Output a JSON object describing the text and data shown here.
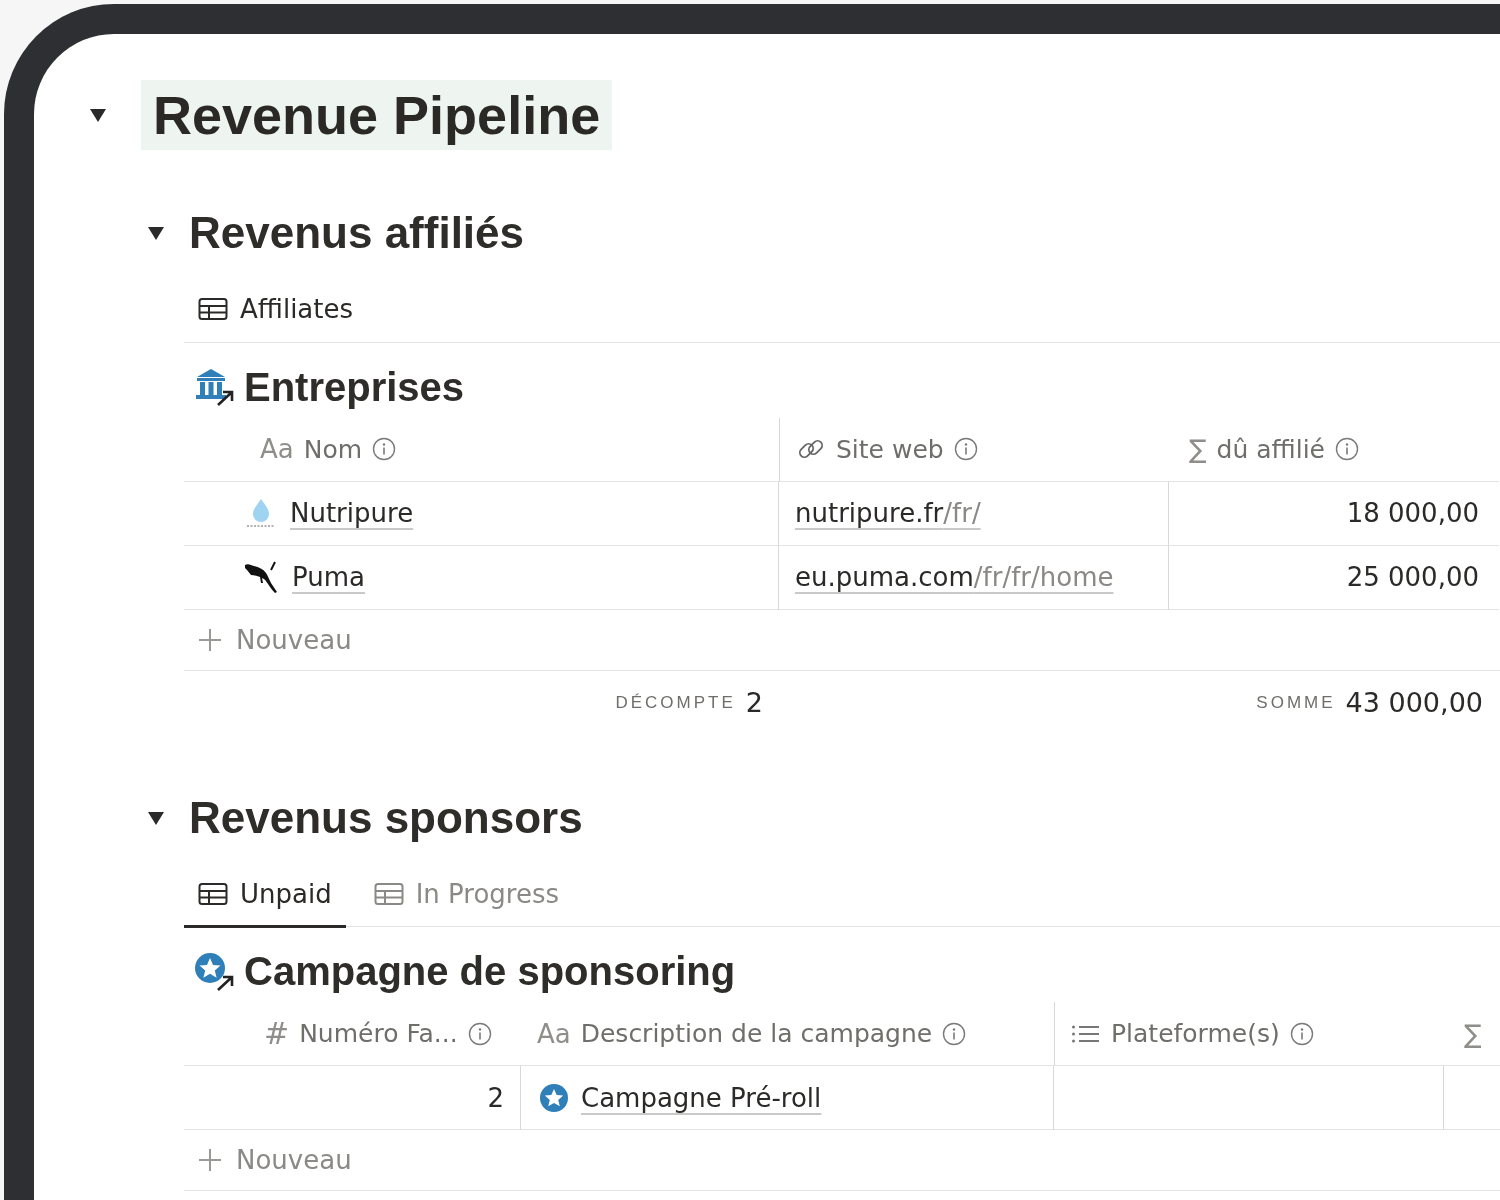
{
  "page": {
    "title": "Revenue Pipeline",
    "expanded": true
  },
  "sections": [
    {
      "heading": "Revenus affiliés",
      "expanded": true,
      "views": [
        {
          "label": "Affiliates",
          "selected": true
        }
      ],
      "database": {
        "title": "Entreprises",
        "columns": [
          {
            "name": "Nom",
            "kind": "title",
            "icon_text": "Aa"
          },
          {
            "name": "Site web",
            "kind": "url"
          },
          {
            "name": "dû affilié",
            "kind": "formula",
            "icon_text": "∑"
          }
        ],
        "rows": [
          [
            {
              "text": "Nutripure"
            },
            {
              "host": "nutripure.fr",
              "path": "/fr/"
            },
            {
              "text": "18 000,00"
            }
          ],
          [
            {
              "text": "Puma"
            },
            {
              "host": "eu.puma.com",
              "path": "/fr/fr/home"
            },
            {
              "text": "25 000,00"
            }
          ]
        ],
        "new_label": "Nouveau",
        "calculations": [
          {
            "kind": "count",
            "label": "DÉCOMPTE",
            "value": "2"
          },
          {
            "kind": "sum",
            "label": "SOMME",
            "value": "43 000,00"
          }
        ]
      }
    },
    {
      "heading": "Revenus sponsors",
      "expanded": true,
      "views": [
        {
          "label": "Unpaid",
          "selected": true
        },
        {
          "label": "In Progress",
          "selected": false
        }
      ],
      "database": {
        "title": "Campagne de sponsoring",
        "columns": [
          {
            "name": "Numéro Fa...",
            "kind": "number",
            "icon_text": "#"
          },
          {
            "name": "Description de la campagne",
            "kind": "title",
            "icon_text": "Aa"
          },
          {
            "name": "Plateforme(s)",
            "kind": "multi_select"
          },
          {
            "kind": "formula",
            "icon_text": "∑"
          }
        ],
        "rows": [
          [
            {
              "text": "2"
            },
            {
              "text": "Campagne Pré-roll"
            },
            {},
            {}
          ]
        ],
        "new_label": "Nouveau"
      }
    }
  ]
}
